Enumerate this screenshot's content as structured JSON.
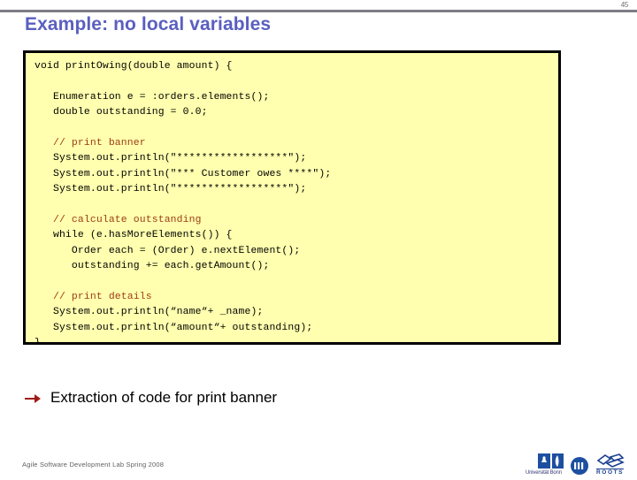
{
  "slide": {
    "page_number": "45",
    "title": "Example: no local variables",
    "accent_title_color": "#5a5fc0",
    "code_bg_color": "#ffffaf",
    "comment_color": "#9b3a13",
    "arrow_color": "#9e1b16"
  },
  "code": {
    "lines": [
      {
        "text": "void printOwing(double amount) {",
        "kind": "code"
      },
      {
        "text": "",
        "kind": "blank"
      },
      {
        "text": "   Enumeration e = :orders.elements();",
        "kind": "code"
      },
      {
        "text": "   double outstanding = 0.0;",
        "kind": "code"
      },
      {
        "text": "",
        "kind": "blank"
      },
      {
        "text": "   // print banner",
        "kind": "comment"
      },
      {
        "text": "   System.out.println(\"******************\");",
        "kind": "code"
      },
      {
        "text": "   System.out.println(\"*** Customer owes ****\");",
        "kind": "code"
      },
      {
        "text": "   System.out.println(\"******************\");",
        "kind": "code"
      },
      {
        "text": "",
        "kind": "blank"
      },
      {
        "text": "   // calculate outstanding",
        "kind": "comment"
      },
      {
        "text": "   while (e.hasMoreElements()) {",
        "kind": "code"
      },
      {
        "text": "      Order each = (Order) e.nextElement();",
        "kind": "code"
      },
      {
        "text": "      outstanding += each.getAmount();",
        "kind": "code"
      },
      {
        "text": "",
        "kind": "blank"
      },
      {
        "text": "   // print details",
        "kind": "comment"
      },
      {
        "text": "   System.out.println(“name“+ _name);",
        "kind": "code"
      },
      {
        "text": "   System.out.println(“amount“+ outstanding);",
        "kind": "code"
      },
      {
        "text": "}",
        "kind": "code"
      }
    ]
  },
  "bullet": {
    "icon": "arrow-right-icon",
    "text": "Extraction of code for print banner"
  },
  "footer": {
    "text": "Agile Software Development Lab Spring 2008",
    "logos": [
      {
        "name": "university-logo",
        "label": "Universität Bonn"
      },
      {
        "name": "fraunhofer-logo",
        "label": ""
      },
      {
        "name": "roots-logo",
        "label": "ROOTS"
      }
    ]
  }
}
